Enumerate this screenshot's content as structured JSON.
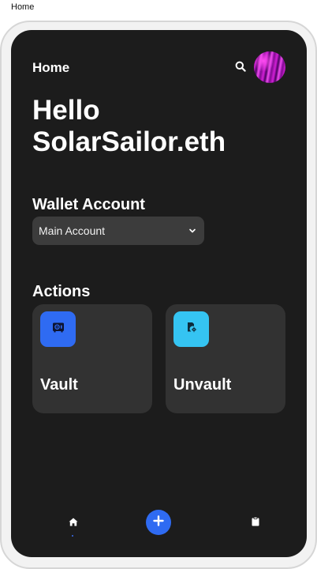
{
  "window": {
    "title": "Home"
  },
  "header": {
    "title": "Home",
    "search_icon": "search-icon",
    "avatar_icon": "avatar"
  },
  "greeting": "Hello SolarSailor.eth",
  "wallet": {
    "heading": "Wallet Account",
    "selected_account": "Main Account",
    "dropdown_icon": "chevron-down-icon"
  },
  "actions": {
    "heading": "Actions",
    "items": [
      {
        "label": "Vault",
        "icon": "vault-icon",
        "color": "#2f6bf2"
      },
      {
        "label": "Unvault",
        "icon": "unvault-icon",
        "color": "#35c4f2"
      }
    ]
  },
  "bottom_nav": {
    "items": [
      {
        "icon": "home-icon",
        "active": true
      },
      {
        "icon": "plus-icon",
        "color": "#2f6bf2"
      },
      {
        "icon": "clipboard-icon"
      }
    ]
  },
  "colors": {
    "background": "#1c1c1c",
    "card": "#323232",
    "select": "#3c3c3c",
    "accent": "#2f6bf2"
  }
}
